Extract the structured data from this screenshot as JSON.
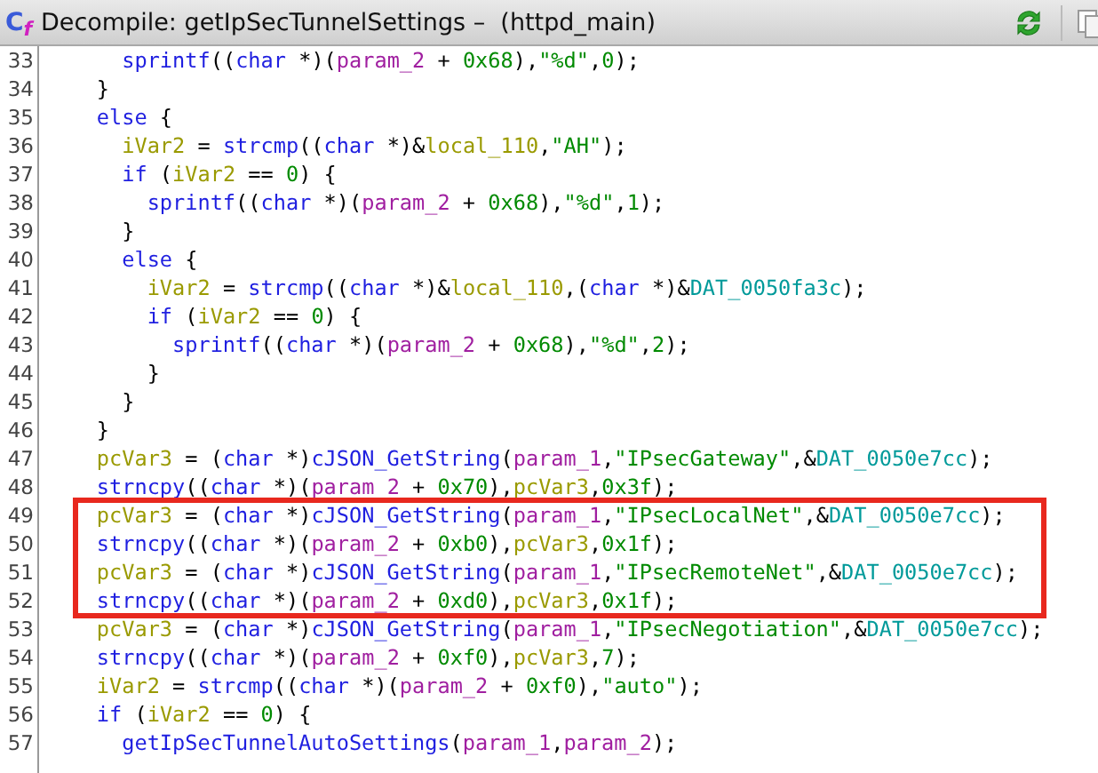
{
  "window": {
    "title": "Decompile: getIpSecTunnelSettings –  (httpd_main)",
    "icon_letters": [
      {
        "text": "C",
        "color": "#3a5bd9"
      },
      {
        "text": "f",
        "color": "#d020c0"
      }
    ]
  },
  "code": {
    "lines": [
      {
        "number": "33",
        "boxed": false,
        "tokens": [
          {
            "text": "      sprintf",
            "kind": "function"
          },
          {
            "text": "((",
            "kind": "plain"
          },
          {
            "text": "char",
            "kind": "keyword"
          },
          {
            "text": " *)(",
            "kind": "plain"
          },
          {
            "text": "param_2",
            "kind": "param"
          },
          {
            "text": " + ",
            "kind": "plain"
          },
          {
            "text": "0x68",
            "kind": "number"
          },
          {
            "text": "),",
            "kind": "plain"
          },
          {
            "text": "\"%d\"",
            "kind": "string"
          },
          {
            "text": ",",
            "kind": "plain"
          },
          {
            "text": "0",
            "kind": "number"
          },
          {
            "text": ");",
            "kind": "plain"
          }
        ]
      },
      {
        "number": "34",
        "boxed": false,
        "tokens": [
          {
            "text": "    }",
            "kind": "plain"
          }
        ]
      },
      {
        "number": "35",
        "boxed": false,
        "tokens": [
          {
            "text": "    else",
            "kind": "keyword"
          },
          {
            "text": " {",
            "kind": "plain"
          }
        ]
      },
      {
        "number": "36",
        "boxed": false,
        "tokens": [
          {
            "text": "      iVar2",
            "kind": "variable"
          },
          {
            "text": " = ",
            "kind": "plain"
          },
          {
            "text": "strcmp",
            "kind": "function"
          },
          {
            "text": "((",
            "kind": "plain"
          },
          {
            "text": "char",
            "kind": "keyword"
          },
          {
            "text": " *)&",
            "kind": "plain"
          },
          {
            "text": "local_110",
            "kind": "variable"
          },
          {
            "text": ",",
            "kind": "plain"
          },
          {
            "text": "\"AH\"",
            "kind": "string"
          },
          {
            "text": ");",
            "kind": "plain"
          }
        ]
      },
      {
        "number": "37",
        "boxed": false,
        "tokens": [
          {
            "text": "      if",
            "kind": "keyword"
          },
          {
            "text": " (",
            "kind": "plain"
          },
          {
            "text": "iVar2",
            "kind": "variable"
          },
          {
            "text": " == ",
            "kind": "plain"
          },
          {
            "text": "0",
            "kind": "number"
          },
          {
            "text": ") {",
            "kind": "plain"
          }
        ]
      },
      {
        "number": "38",
        "boxed": false,
        "tokens": [
          {
            "text": "        sprintf",
            "kind": "function"
          },
          {
            "text": "((",
            "kind": "plain"
          },
          {
            "text": "char",
            "kind": "keyword"
          },
          {
            "text": " *)(",
            "kind": "plain"
          },
          {
            "text": "param_2",
            "kind": "param"
          },
          {
            "text": " + ",
            "kind": "plain"
          },
          {
            "text": "0x68",
            "kind": "number"
          },
          {
            "text": "),",
            "kind": "plain"
          },
          {
            "text": "\"%d\"",
            "kind": "string"
          },
          {
            "text": ",",
            "kind": "plain"
          },
          {
            "text": "1",
            "kind": "number"
          },
          {
            "text": ");",
            "kind": "plain"
          }
        ]
      },
      {
        "number": "39",
        "boxed": false,
        "tokens": [
          {
            "text": "      }",
            "kind": "plain"
          }
        ]
      },
      {
        "number": "40",
        "boxed": false,
        "tokens": [
          {
            "text": "      else",
            "kind": "keyword"
          },
          {
            "text": " {",
            "kind": "plain"
          }
        ]
      },
      {
        "number": "41",
        "boxed": false,
        "tokens": [
          {
            "text": "        iVar2",
            "kind": "variable"
          },
          {
            "text": " = ",
            "kind": "plain"
          },
          {
            "text": "strcmp",
            "kind": "function"
          },
          {
            "text": "((",
            "kind": "plain"
          },
          {
            "text": "char",
            "kind": "keyword"
          },
          {
            "text": " *)&",
            "kind": "plain"
          },
          {
            "text": "local_110",
            "kind": "variable"
          },
          {
            "text": ",(",
            "kind": "plain"
          },
          {
            "text": "char",
            "kind": "keyword"
          },
          {
            "text": " *)&",
            "kind": "plain"
          },
          {
            "text": "DAT_0050fa3c",
            "kind": "global"
          },
          {
            "text": ");",
            "kind": "plain"
          }
        ]
      },
      {
        "number": "42",
        "boxed": false,
        "tokens": [
          {
            "text": "        if",
            "kind": "keyword"
          },
          {
            "text": " (",
            "kind": "plain"
          },
          {
            "text": "iVar2",
            "kind": "variable"
          },
          {
            "text": " == ",
            "kind": "plain"
          },
          {
            "text": "0",
            "kind": "number"
          },
          {
            "text": ") {",
            "kind": "plain"
          }
        ]
      },
      {
        "number": "43",
        "boxed": false,
        "tokens": [
          {
            "text": "          sprintf",
            "kind": "function"
          },
          {
            "text": "((",
            "kind": "plain"
          },
          {
            "text": "char",
            "kind": "keyword"
          },
          {
            "text": " *)(",
            "kind": "plain"
          },
          {
            "text": "param_2",
            "kind": "param"
          },
          {
            "text": " + ",
            "kind": "plain"
          },
          {
            "text": "0x68",
            "kind": "number"
          },
          {
            "text": "),",
            "kind": "plain"
          },
          {
            "text": "\"%d\"",
            "kind": "string"
          },
          {
            "text": ",",
            "kind": "plain"
          },
          {
            "text": "2",
            "kind": "number"
          },
          {
            "text": ");",
            "kind": "plain"
          }
        ]
      },
      {
        "number": "44",
        "boxed": false,
        "tokens": [
          {
            "text": "        }",
            "kind": "plain"
          }
        ]
      },
      {
        "number": "45",
        "boxed": false,
        "tokens": [
          {
            "text": "      }",
            "kind": "plain"
          }
        ]
      },
      {
        "number": "46",
        "boxed": false,
        "tokens": [
          {
            "text": "    }",
            "kind": "plain"
          }
        ]
      },
      {
        "number": "47",
        "boxed": false,
        "tokens": [
          {
            "text": "    pcVar3",
            "kind": "variable"
          },
          {
            "text": " = (",
            "kind": "plain"
          },
          {
            "text": "char",
            "kind": "keyword"
          },
          {
            "text": " *)",
            "kind": "plain"
          },
          {
            "text": "cJSON_GetString",
            "kind": "function"
          },
          {
            "text": "(",
            "kind": "plain"
          },
          {
            "text": "param_1",
            "kind": "param"
          },
          {
            "text": ",",
            "kind": "plain"
          },
          {
            "text": "\"IPsecGateway\"",
            "kind": "string"
          },
          {
            "text": ",&",
            "kind": "plain"
          },
          {
            "text": "DAT_0050e7cc",
            "kind": "global"
          },
          {
            "text": ");",
            "kind": "plain"
          }
        ]
      },
      {
        "number": "48",
        "boxed": false,
        "tokens": [
          {
            "text": "    strncpy",
            "kind": "function"
          },
          {
            "text": "((",
            "kind": "plain"
          },
          {
            "text": "char",
            "kind": "keyword"
          },
          {
            "text": " *)(",
            "kind": "plain"
          },
          {
            "text": "param_2",
            "kind": "param"
          },
          {
            "text": " + ",
            "kind": "plain"
          },
          {
            "text": "0x70",
            "kind": "number"
          },
          {
            "text": "),",
            "kind": "plain"
          },
          {
            "text": "pcVar3",
            "kind": "variable"
          },
          {
            "text": ",",
            "kind": "plain"
          },
          {
            "text": "0x3f",
            "kind": "number"
          },
          {
            "text": ");",
            "kind": "plain"
          }
        ]
      },
      {
        "number": "49",
        "boxed": true,
        "tokens": [
          {
            "text": "    pcVar3",
            "kind": "variable"
          },
          {
            "text": " = (",
            "kind": "plain"
          },
          {
            "text": "char",
            "kind": "keyword"
          },
          {
            "text": " *)",
            "kind": "plain"
          },
          {
            "text": "cJSON_GetString",
            "kind": "function"
          },
          {
            "text": "(",
            "kind": "plain"
          },
          {
            "text": "param_1",
            "kind": "param"
          },
          {
            "text": ",",
            "kind": "plain"
          },
          {
            "text": "\"IPsecLocalNet\"",
            "kind": "string"
          },
          {
            "text": ",&",
            "kind": "plain"
          },
          {
            "text": "DAT_0050e7cc",
            "kind": "global"
          },
          {
            "text": ");",
            "kind": "plain"
          }
        ]
      },
      {
        "number": "50",
        "boxed": true,
        "tokens": [
          {
            "text": "    strncpy",
            "kind": "function"
          },
          {
            "text": "((",
            "kind": "plain"
          },
          {
            "text": "char",
            "kind": "keyword"
          },
          {
            "text": " *)(",
            "kind": "plain"
          },
          {
            "text": "param_2",
            "kind": "param"
          },
          {
            "text": " + ",
            "kind": "plain"
          },
          {
            "text": "0xb0",
            "kind": "number"
          },
          {
            "text": "),",
            "kind": "plain"
          },
          {
            "text": "pcVar3",
            "kind": "variable"
          },
          {
            "text": ",",
            "kind": "plain"
          },
          {
            "text": "0x1f",
            "kind": "number"
          },
          {
            "text": ");",
            "kind": "plain"
          }
        ]
      },
      {
        "number": "51",
        "boxed": true,
        "tokens": [
          {
            "text": "    pcVar3",
            "kind": "variable"
          },
          {
            "text": " = (",
            "kind": "plain"
          },
          {
            "text": "char",
            "kind": "keyword"
          },
          {
            "text": " *)",
            "kind": "plain"
          },
          {
            "text": "cJSON_GetString",
            "kind": "function"
          },
          {
            "text": "(",
            "kind": "plain"
          },
          {
            "text": "param_1",
            "kind": "param"
          },
          {
            "text": ",",
            "kind": "plain"
          },
          {
            "text": "\"IPsecRemoteNet\"",
            "kind": "string"
          },
          {
            "text": ",&",
            "kind": "plain"
          },
          {
            "text": "DAT_0050e7cc",
            "kind": "global"
          },
          {
            "text": ");",
            "kind": "plain"
          }
        ]
      },
      {
        "number": "52",
        "boxed": true,
        "tokens": [
          {
            "text": "    strncpy",
            "kind": "function"
          },
          {
            "text": "((",
            "kind": "plain"
          },
          {
            "text": "char",
            "kind": "keyword"
          },
          {
            "text": " *)(",
            "kind": "plain"
          },
          {
            "text": "param_2",
            "kind": "param"
          },
          {
            "text": " + ",
            "kind": "plain"
          },
          {
            "text": "0xd0",
            "kind": "number"
          },
          {
            "text": "),",
            "kind": "plain"
          },
          {
            "text": "pcVar3",
            "kind": "variable"
          },
          {
            "text": ",",
            "kind": "plain"
          },
          {
            "text": "0x1f",
            "kind": "number"
          },
          {
            "text": ");",
            "kind": "plain"
          }
        ]
      },
      {
        "number": "53",
        "boxed": false,
        "tokens": [
          {
            "text": "    pcVar3",
            "kind": "variable"
          },
          {
            "text": " = (",
            "kind": "plain"
          },
          {
            "text": "char",
            "kind": "keyword"
          },
          {
            "text": " *)",
            "kind": "plain"
          },
          {
            "text": "cJSON_GetString",
            "kind": "function"
          },
          {
            "text": "(",
            "kind": "plain"
          },
          {
            "text": "param_1",
            "kind": "param"
          },
          {
            "text": ",",
            "kind": "plain"
          },
          {
            "text": "\"IPsecNegotiation\"",
            "kind": "string"
          },
          {
            "text": ",&",
            "kind": "plain"
          },
          {
            "text": "DAT_0050e7cc",
            "kind": "global"
          },
          {
            "text": ");",
            "kind": "plain"
          }
        ]
      },
      {
        "number": "54",
        "boxed": false,
        "tokens": [
          {
            "text": "    strncpy",
            "kind": "function"
          },
          {
            "text": "((",
            "kind": "plain"
          },
          {
            "text": "char",
            "kind": "keyword"
          },
          {
            "text": " *)(",
            "kind": "plain"
          },
          {
            "text": "param_2",
            "kind": "param"
          },
          {
            "text": " + ",
            "kind": "plain"
          },
          {
            "text": "0xf0",
            "kind": "number"
          },
          {
            "text": "),",
            "kind": "plain"
          },
          {
            "text": "pcVar3",
            "kind": "variable"
          },
          {
            "text": ",",
            "kind": "plain"
          },
          {
            "text": "7",
            "kind": "number"
          },
          {
            "text": ");",
            "kind": "plain"
          }
        ]
      },
      {
        "number": "55",
        "boxed": false,
        "tokens": [
          {
            "text": "    iVar2",
            "kind": "variable"
          },
          {
            "text": " = ",
            "kind": "plain"
          },
          {
            "text": "strcmp",
            "kind": "function"
          },
          {
            "text": "((",
            "kind": "plain"
          },
          {
            "text": "char",
            "kind": "keyword"
          },
          {
            "text": " *)(",
            "kind": "plain"
          },
          {
            "text": "param_2",
            "kind": "param"
          },
          {
            "text": " + ",
            "kind": "plain"
          },
          {
            "text": "0xf0",
            "kind": "number"
          },
          {
            "text": "),",
            "kind": "plain"
          },
          {
            "text": "\"auto\"",
            "kind": "string"
          },
          {
            "text": ");",
            "kind": "plain"
          }
        ]
      },
      {
        "number": "56",
        "boxed": false,
        "tokens": [
          {
            "text": "    if",
            "kind": "keyword"
          },
          {
            "text": " (",
            "kind": "plain"
          },
          {
            "text": "iVar2",
            "kind": "variable"
          },
          {
            "text": " == ",
            "kind": "plain"
          },
          {
            "text": "0",
            "kind": "number"
          },
          {
            "text": ") {",
            "kind": "plain"
          }
        ]
      },
      {
        "number": "57",
        "boxed": false,
        "tokens": [
          {
            "text": "      getIpSecTunnelAutoSettings",
            "kind": "function"
          },
          {
            "text": "(",
            "kind": "plain"
          },
          {
            "text": "param_1",
            "kind": "param"
          },
          {
            "text": ",",
            "kind": "plain"
          },
          {
            "text": "param_2",
            "kind": "param"
          },
          {
            "text": ");",
            "kind": "plain"
          }
        ]
      }
    ]
  }
}
